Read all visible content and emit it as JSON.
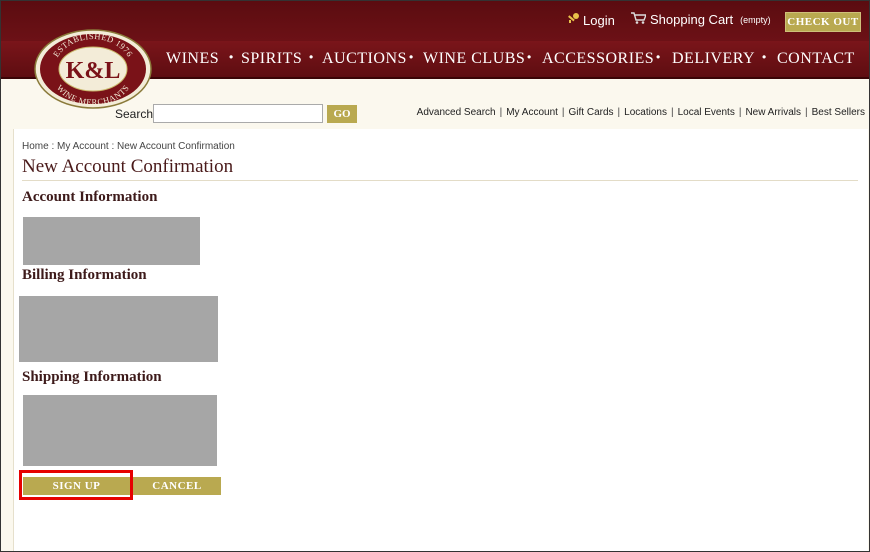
{
  "header": {
    "login_label": "Login",
    "cart_label": "Shopping Cart",
    "cart_status": "(empty)",
    "checkout_label": "CHECK OUT"
  },
  "nav": {
    "items": [
      {
        "label": "WINES"
      },
      {
        "label": "SPIRITS"
      },
      {
        "label": "AUCTIONS"
      },
      {
        "label": "WINE CLUBS"
      },
      {
        "label": "ACCESSORIES"
      },
      {
        "label": "DELIVERY"
      },
      {
        "label": "CONTACT"
      }
    ],
    "separator": "•"
  },
  "logo": {
    "top_text": "ESTABLISHED 1976",
    "monogram": "K&L",
    "bottom_text": "WINE MERCHANTS"
  },
  "search": {
    "label": "Search",
    "value": "",
    "placeholder": "",
    "go_label": "GO"
  },
  "toplinks": [
    "Advanced Search",
    "My Account",
    "Gift Cards",
    "Locations",
    "Local Events",
    "New Arrivals",
    "Best Sellers"
  ],
  "breadcrumb": "Home :  My Account : New Account Confirmation",
  "page": {
    "title": "New Account Confirmation",
    "account_heading": "Account Information",
    "billing_heading": "Billing Information",
    "shipping_heading": "Shipping Information"
  },
  "actions": {
    "signup_label": "SIGN UP",
    "cancel_label": "CANCEL"
  },
  "icons": {
    "login": "key-icon",
    "cart": "cart-icon"
  },
  "colors": {
    "maroon": "#6c1116",
    "gold": "#b9a950",
    "highlight": "#e60000"
  }
}
